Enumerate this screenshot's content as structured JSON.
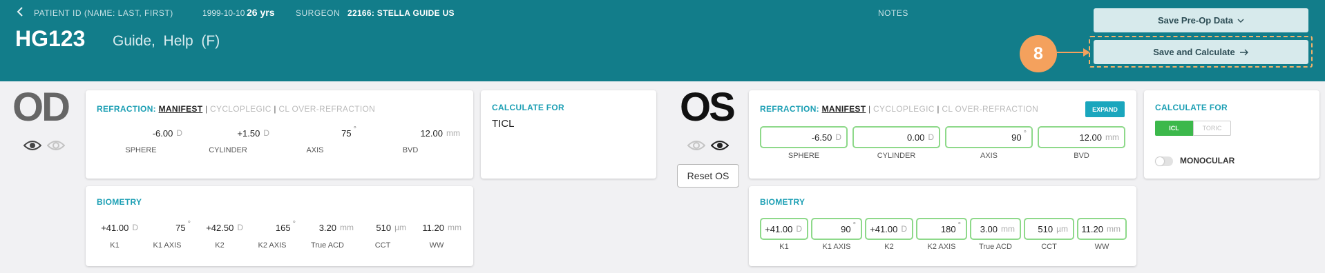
{
  "header": {
    "back_icon": "chevron-left-icon",
    "patient_id_label": "PATIENT ID (NAME: LAST, FIRST)",
    "dob": "1999-10-10",
    "age": "26 yrs",
    "surgeon_label": "SURGEON",
    "surgeon_value": "22166: STELLA GUIDE US",
    "notes_label": "NOTES",
    "patient_id": "HG123",
    "patient_name": "Guide,  Help  (F)",
    "save_preop_label": "Save Pre-Op Data",
    "save_calc_label": "Save and Calculate",
    "step_badge": "8",
    "accent_color": "#127d8a",
    "highlight_color": "#f4a15d"
  },
  "od": {
    "label": "OD",
    "refraction": {
      "title_prefix": "REFRACTION:",
      "tab_manifest": "MANIFEST",
      "sep": "|",
      "tab_cycloplegic": "CYCLOPLEGIC",
      "tab_cl": "CL OVER-REFRACTION",
      "sphere": "-6.00",
      "sphere_unit": "D",
      "cylinder": "+1.50",
      "cylinder_unit": "D",
      "axis": "75",
      "axis_unit": "°",
      "bvd": "12.00",
      "bvd_unit": "mm",
      "labels": [
        "SPHERE",
        "CYLINDER",
        "AXIS",
        "BVD"
      ]
    },
    "calculate": {
      "title": "CALCULATE FOR",
      "value": "TICL"
    },
    "biometry": {
      "title": "BIOMETRY",
      "values": [
        "+41.00",
        "75",
        "+42.50",
        "165",
        "3.20",
        "510",
        "11.20"
      ],
      "units": [
        "D",
        "°",
        "D",
        "°",
        "mm",
        "µm",
        "mm"
      ],
      "labels": [
        "K1",
        "K1 AXIS",
        "K2",
        "K2 AXIS",
        "True ACD",
        "CCT",
        "WW"
      ]
    }
  },
  "os": {
    "label": "OS",
    "reset_label": "Reset OS",
    "refraction": {
      "title_prefix": "REFRACTION:",
      "tab_manifest": "MANIFEST",
      "sep": "|",
      "tab_cycloplegic": "CYCLOPLEGIC",
      "tab_cl": "CL OVER-REFRACTION",
      "expand_label": "EXPAND",
      "sphere": "-6.50",
      "sphere_unit": "D",
      "cylinder": "0.00",
      "cylinder_unit": "D",
      "axis": "90",
      "axis_unit": "°",
      "bvd": "12.00",
      "bvd_unit": "mm",
      "labels": [
        "SPHERE",
        "CYLINDER",
        "AXIS",
        "BVD"
      ]
    },
    "calculate": {
      "title": "CALCULATE FOR",
      "icl_label": "ICL",
      "toric_label": "TORIC",
      "monocular_label": "MONOCULAR"
    },
    "biometry": {
      "title": "BIOMETRY",
      "values": [
        "+41.00",
        "90",
        "+41.00",
        "180",
        "3.00",
        "510",
        "11.20"
      ],
      "units": [
        "D",
        "°",
        "D",
        "°",
        "mm",
        "µm",
        "mm"
      ],
      "labels": [
        "K1",
        "K1 AXIS",
        "K2",
        "K2 AXIS",
        "True ACD",
        "CCT",
        "WW"
      ]
    }
  }
}
